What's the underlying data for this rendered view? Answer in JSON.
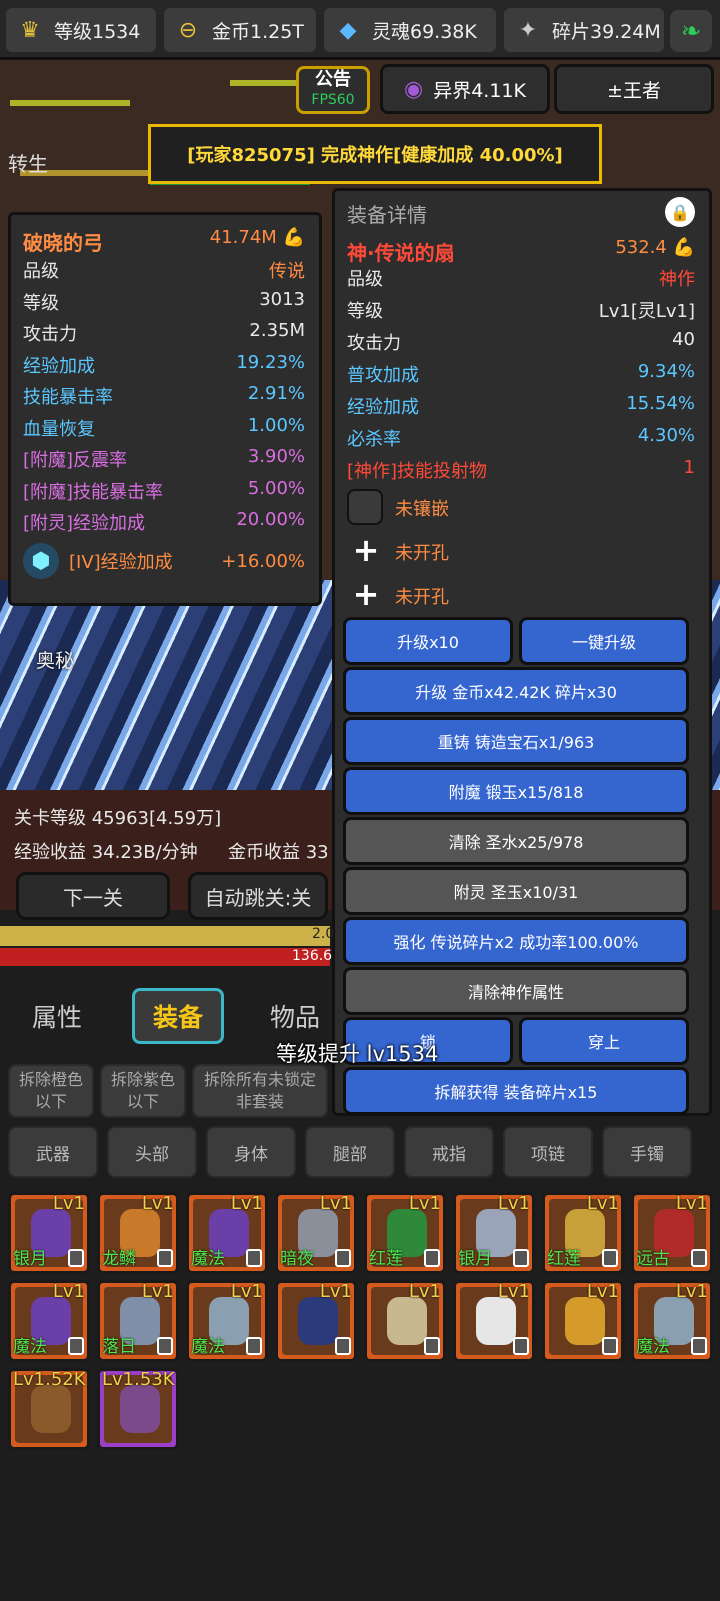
{
  "topbar": {
    "level": "等级1534",
    "gold": "金币1.25T",
    "soul": "灵魂69.38K",
    "shards": "碎片39.24M"
  },
  "hud": {
    "announce": "公告",
    "fps": "FPS60",
    "otherworld": "异界4.11K",
    "king": "±王者",
    "rebirth": "转生"
  },
  "notice": "[玩家825075] 完成神作[健康加成 40.00%]",
  "left_item": {
    "name": "破晓的弓",
    "power": "41.74M",
    "rows": [
      {
        "label": "品级",
        "value": "传说",
        "color": "o"
      },
      {
        "label": "等级",
        "value": "3013",
        "color": "w"
      },
      {
        "label": "攻击力",
        "value": "2.35M",
        "color": "w"
      },
      {
        "label": "经验加成",
        "value": "19.23%",
        "color": "b"
      },
      {
        "label": "技能暴击率",
        "value": "2.91%",
        "color": "b"
      },
      {
        "label": "血量恢复",
        "value": "1.00%",
        "color": "b"
      },
      {
        "label": "[附魔]反震率",
        "value": "3.90%",
        "color": "p"
      },
      {
        "label": "[附魔]技能暴击率",
        "value": "5.00%",
        "color": "p"
      },
      {
        "label": "[附灵]经验加成",
        "value": "20.00%",
        "color": "p"
      }
    ],
    "gem_label": "[IV]经验加成",
    "gem_value": "+16.00%"
  },
  "detail": {
    "header": "装备详情",
    "name": "神·传说的扇",
    "power": "532.4",
    "rows": [
      {
        "label": "品级",
        "value": "神作",
        "color": "r"
      },
      {
        "label": "等级",
        "value": "Lv1[灵Lv1]",
        "color": "w"
      },
      {
        "label": "攻击力",
        "value": "40",
        "color": "w"
      },
      {
        "label": "普攻加成",
        "value": "9.34%",
        "color": "b"
      },
      {
        "label": "经验加成",
        "value": "15.54%",
        "color": "b"
      },
      {
        "label": "必杀率",
        "value": "4.30%",
        "color": "b"
      },
      {
        "label": "[神作]技能投射物",
        "value": "1",
        "color": "r"
      }
    ],
    "socket_empty": "未镶嵌",
    "socket_closed": "未开孔",
    "buttons": {
      "upgrade10": "升级x10",
      "oneclick": "一键升级",
      "upgrade_cost": "升级 金币x42.42K 碎片x30",
      "reforge": "重铸 铸造宝石x1/963",
      "enchant": "附魔 锻玉x15/818",
      "clear": "清除 圣水x25/978",
      "spirit": "附灵 圣玉x10/31",
      "strengthen": "强化 传说碎片x2 成功率100.00%",
      "clear_divine": "清除神作属性",
      "lock": "锁",
      "equip": "穿上",
      "dismantle": "拆解获得 装备碎片x15"
    }
  },
  "scene": {
    "mystery": "奥秘",
    "stage": "关卡等级 45963[4.59万]",
    "exp_income": "经验收益 34.23B/分钟",
    "gold_income": "金币收益 33",
    "next": "下一关",
    "auto": "自动跳关:关",
    "bar1": "2.0",
    "bar2": "136.6"
  },
  "toast": "等级提升 lv1534",
  "tabs": {
    "attr": "属性",
    "equip": "装备",
    "items": "物品"
  },
  "filters": {
    "orange": "拆除橙色以下",
    "purple": "拆除紫色以下",
    "unlocked": "拆除所有未锁定非套装"
  },
  "categories": [
    "武器",
    "头部",
    "身体",
    "腿部",
    "戒指",
    "项链",
    "手镯"
  ],
  "inventory": [
    {
      "lv": "Lv1",
      "name": "银月",
      "tint": "#6b3fa8"
    },
    {
      "lv": "Lv1",
      "name": "龙鳞",
      "tint": "#c87a2a"
    },
    {
      "lv": "Lv1",
      "name": "魔法",
      "tint": "#6b3fa8"
    },
    {
      "lv": "Lv1",
      "name": "暗夜",
      "tint": "#8a8f9a"
    },
    {
      "lv": "Lv1",
      "name": "红莲",
      "tint": "#2e8a3a"
    },
    {
      "lv": "Lv1",
      "name": "银月",
      "tint": "#9aa4b8"
    },
    {
      "lv": "Lv1",
      "name": "红莲",
      "tint": "#c8a03a"
    },
    {
      "lv": "Lv1",
      "name": "远古",
      "tint": "#b02a2a"
    },
    {
      "lv": "Lv1",
      "name": "魔法",
      "tint": "#6b3fa8"
    },
    {
      "lv": "Lv1",
      "name": "落日",
      "tint": "#7f8fa8"
    },
    {
      "lv": "Lv1",
      "name": "魔法",
      "tint": "#8aa0b0"
    },
    {
      "lv": "Lv1",
      "name": "",
      "tint": "#2a3a7a"
    },
    {
      "lv": "Lv1",
      "name": "",
      "tint": "#c8b890"
    },
    {
      "lv": "Lv1",
      "name": "",
      "tint": "#e6e6e6"
    },
    {
      "lv": "Lv1",
      "name": "",
      "tint": "#d49a2a"
    },
    {
      "lv": "Lv1",
      "name": "魔法",
      "tint": "#8aa0b0"
    },
    {
      "lv": "Lv1.52K",
      "name": "",
      "tint": "#8a5a2a"
    },
    {
      "lv": "Lv1.53K",
      "name": "",
      "tint": "#7a4a8a"
    }
  ]
}
